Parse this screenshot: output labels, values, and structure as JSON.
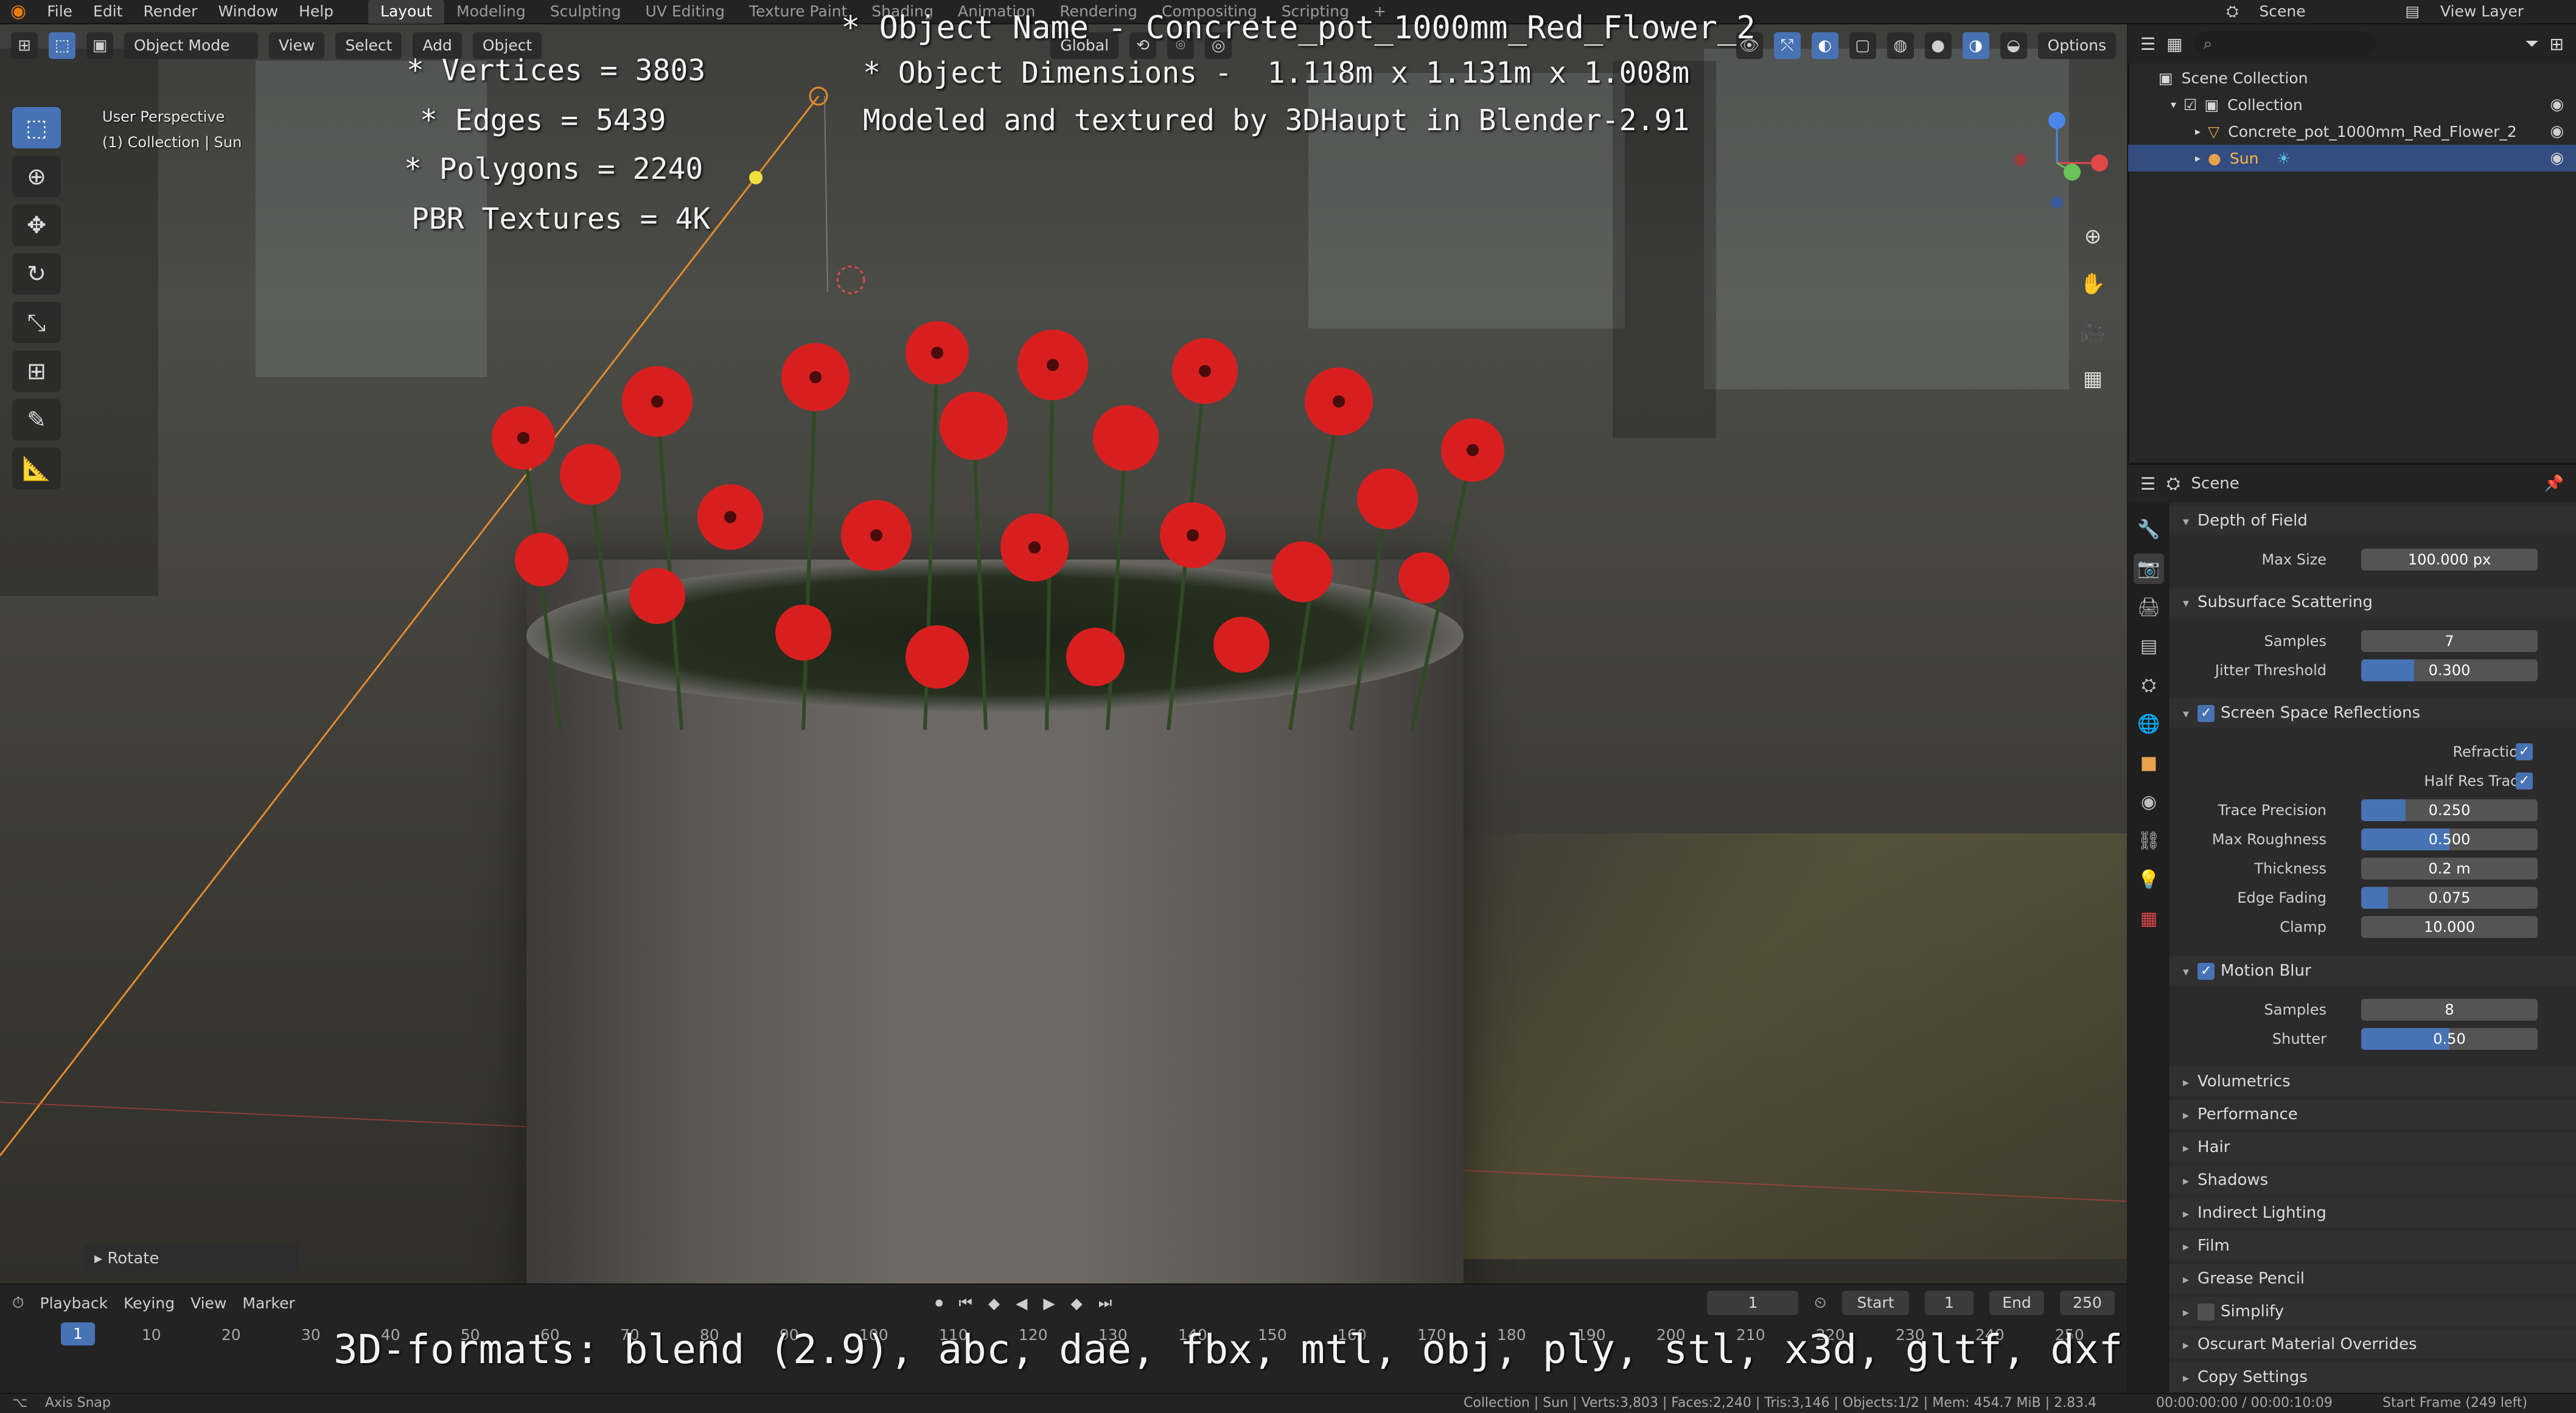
{
  "topbar": {
    "menus": [
      "File",
      "Edit",
      "Render",
      "Window",
      "Help"
    ],
    "workspaces": [
      "Layout",
      "Modeling",
      "Sculpting",
      "UV Editing",
      "Texture Paint",
      "Shading",
      "Animation",
      "Rendering",
      "Compositing",
      "Scripting"
    ],
    "active_workspace": "Layout",
    "scene": "Scene",
    "view_layer": "View Layer"
  },
  "viewport": {
    "mode": "Object Mode",
    "menus": [
      "View",
      "Select",
      "Add",
      "Object"
    ],
    "transform_orientation": "Global",
    "options_label": "Options",
    "perspective_label": "User Perspective",
    "collection_label": "(1) Collection | Sun",
    "rotate_panel_label": "Rotate"
  },
  "overlay_text": {
    "stats": [
      "* Vertices = 3803",
      "* Edges = 5439",
      "* Polygons = 2240",
      "PBR Textures = 4K"
    ],
    "object_name": "* Object Name - Concrete_pot_1000mm_Red_Flower_2",
    "object_dimensions": "* Object Dimensions -  1.118m x 1.131m x 1.008m",
    "credit": "Modeled and textured by 3DHaupt in Blender-2.91",
    "formats": "3D-formats: blend (2.9), abc, dae, fbx, mtl, obj, ply, stl, x3d, gltf, dxf"
  },
  "timeline": {
    "menus": [
      "Playback",
      "Keying",
      "View",
      "Marker"
    ],
    "current_frame": "1",
    "start_label": "Start",
    "start": "1",
    "end_label": "End",
    "end": "250",
    "ticks": [
      "1",
      "10",
      "20",
      "30",
      "40",
      "50",
      "60",
      "70",
      "80",
      "90",
      "100",
      "110",
      "120",
      "130",
      "140",
      "150",
      "160",
      "170",
      "180",
      "190",
      "200",
      "210",
      "220",
      "230",
      "240",
      "250"
    ]
  },
  "statusbar": {
    "left": "Axis Snap",
    "stats": "Collection | Sun | Verts:3,803 | Faces:2,240 | Tris:3,146 | Objects:1/2 | Mem: 454.7 MiB | 2.83.4",
    "time": "00:00:00:00 / 00:00:10:09",
    "start_frame": "Start Frame (249 left)"
  },
  "outliner": {
    "rows": [
      {
        "label": "Scene Collection"
      },
      {
        "label": "Collection"
      },
      {
        "label": "Concrete_pot_1000mm_Red_Flower_2"
      },
      {
        "label": "Sun"
      }
    ]
  },
  "properties": {
    "context": "Scene",
    "panels": {
      "dof": {
        "title": "Depth of Field",
        "max_size_label": "Max Size",
        "max_size": "100.000 px"
      },
      "sss": {
        "title": "Subsurface Scattering",
        "samples_label": "Samples",
        "samples": "7",
        "jitter_label": "Jitter Threshold",
        "jitter": "0.300",
        "jitter_fraction": 0.3
      },
      "ssr": {
        "title": "Screen Space Reflections",
        "refraction_label": "Refraction",
        "half_res_label": "Half Res Trace",
        "trace_label": "Trace Precision",
        "trace": "0.250",
        "trace_fraction": 0.25,
        "roughness_label": "Max Roughness",
        "roughness": "0.500",
        "roughness_fraction": 0.5,
        "thickness_label": "Thickness",
        "thickness": "0.2 m",
        "edge_label": "Edge Fading",
        "edge": "0.075",
        "edge_fraction": 0.15,
        "clamp_label": "Clamp",
        "clamp": "10.000"
      },
      "mblur": {
        "title": "Motion Blur",
        "samples_label": "Samples",
        "samples": "8",
        "shutter_label": "Shutter",
        "shutter": "0.50",
        "shutter_fraction": 0.5
      },
      "collapsed": [
        "Volumetrics",
        "Performance",
        "Hair",
        "Shadows",
        "Indirect Lighting",
        "Film",
        "Grease Pencil",
        "Simplify",
        "Oscurart Material Overrides",
        "Copy Settings"
      ]
    }
  },
  "colors": {
    "accent": "#4772b3",
    "selection": "#334d80",
    "flower": "#d81f1f"
  }
}
